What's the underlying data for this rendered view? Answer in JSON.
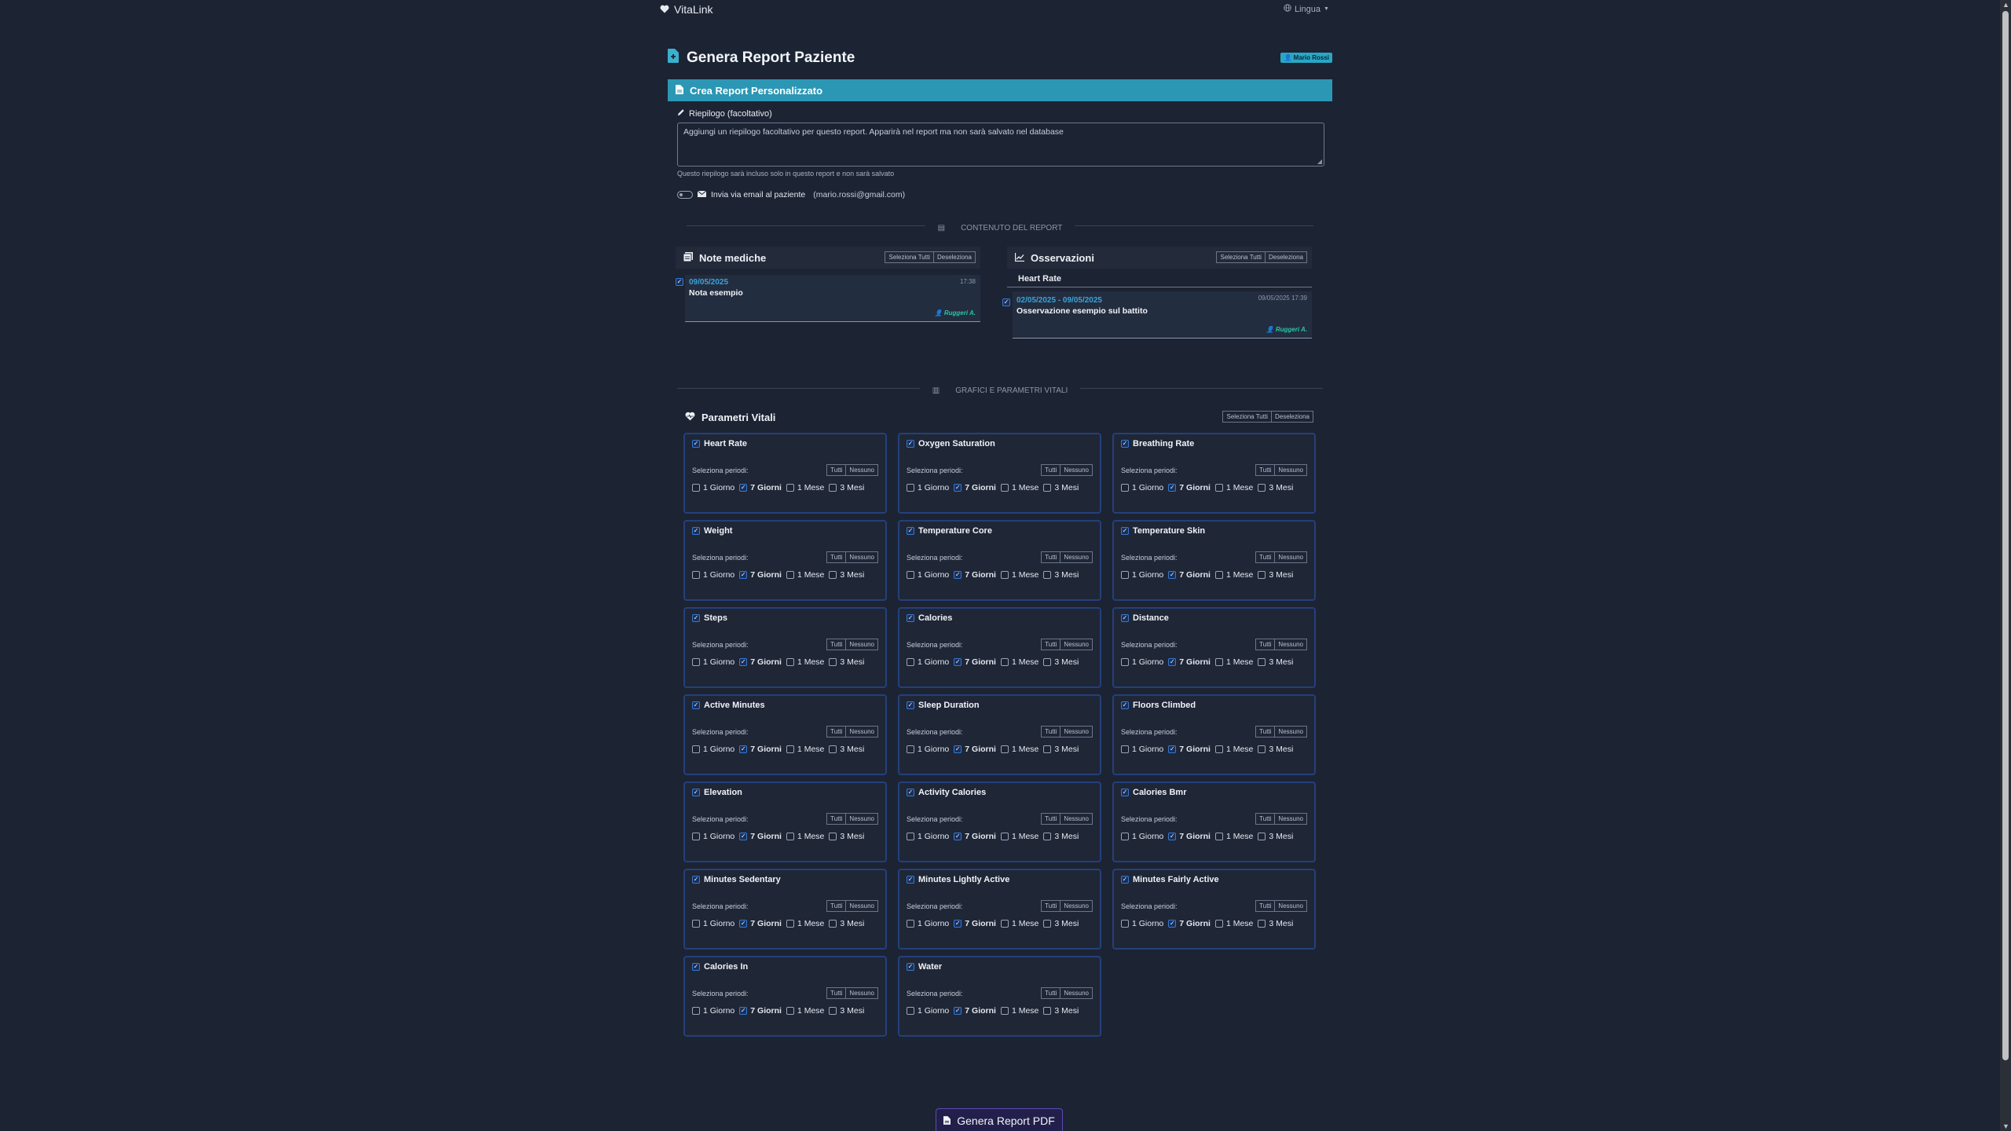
{
  "navbar": {
    "brand": "VitaLink",
    "language": "Lingua"
  },
  "page": {
    "title": "Genera Report Paziente",
    "user_badge": "Mario Rossi"
  },
  "card": {
    "header": "Crea Report Personalizzato"
  },
  "summary": {
    "label": "Riepilogo (facoltativo)",
    "placeholder": "Aggiungi un riepilogo facoltativo per questo report. Apparirà nel report ma non sarà salvato nel database",
    "hint": "Questo riepilogo sarà incluso solo in questo report e non sarà salvato"
  },
  "email": {
    "label": "Invia via email al paziente",
    "address": "(mario.rossi@gmail.com)"
  },
  "dividers": {
    "content": "CONTENUTO DEL REPORT",
    "charts": "GRAFICI E PARAMETRI VITALI"
  },
  "buttons": {
    "select_all": "Seleziona Tutti",
    "deselect": "Deseleziona",
    "all": "Tutti",
    "none": "Nessuno"
  },
  "notes": {
    "title": "Note mediche",
    "items": [
      {
        "date": "09/05/2025",
        "text": "Nota esempio",
        "time": "17:38",
        "author": "Ruggeri A."
      }
    ]
  },
  "observations": {
    "title": "Osservazioni",
    "group": "Heart Rate",
    "items": [
      {
        "date": "02/05/2025 - 09/05/2025",
        "text": "Osservazione esempio sul battito",
        "time": "09/05/2025 17:39",
        "author": "Ruggeri A."
      }
    ]
  },
  "vitals": {
    "title": "Parametri Vitali",
    "period_label": "Seleziona periodi:",
    "periods": [
      "1 Giorno",
      "7 Giorni",
      "1 Mese",
      "3 Mesi"
    ],
    "items": [
      {
        "name": "Heart Rate"
      },
      {
        "name": "Oxygen Saturation"
      },
      {
        "name": "Breathing Rate"
      },
      {
        "name": "Weight"
      },
      {
        "name": "Temperature Core"
      },
      {
        "name": "Temperature Skin"
      },
      {
        "name": "Steps"
      },
      {
        "name": "Calories"
      },
      {
        "name": "Distance"
      },
      {
        "name": "Active Minutes"
      },
      {
        "name": "Sleep Duration"
      },
      {
        "name": "Floors Climbed"
      },
      {
        "name": "Elevation"
      },
      {
        "name": "Activity Calories"
      },
      {
        "name": "Calories Bmr"
      },
      {
        "name": "Minutes Sedentary"
      },
      {
        "name": "Minutes Lightly Active"
      },
      {
        "name": "Minutes Fairly Active"
      },
      {
        "name": "Calories In"
      },
      {
        "name": "Water"
      }
    ]
  },
  "generate_button": "Genera Report PDF"
}
